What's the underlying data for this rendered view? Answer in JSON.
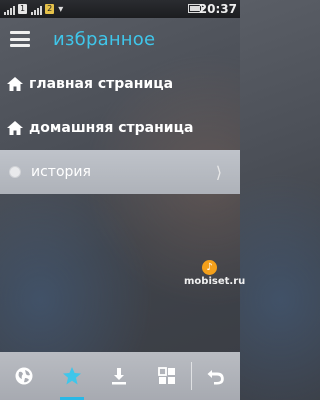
{
  "status_bar": {
    "sim1": "1",
    "sim2": "2",
    "time": "20:37"
  },
  "header": {
    "title": "избранное"
  },
  "list": {
    "items": [
      {
        "label": "главная страница",
        "icon": "home-icon"
      },
      {
        "label": "домашняя страница",
        "icon": "home-icon"
      },
      {
        "label": "история",
        "icon": "radio-icon",
        "selected": true
      }
    ]
  },
  "watermark": {
    "text": "mobiset.ru"
  },
  "toolbar": {
    "buttons": [
      {
        "icon": "globe-icon"
      },
      {
        "icon": "star-icon",
        "active": true
      },
      {
        "icon": "download-icon"
      },
      {
        "icon": "grid-icon"
      },
      {
        "icon": "back-icon"
      }
    ]
  },
  "colors": {
    "accent": "#3fc6ea",
    "selection": "#b8bcc3"
  }
}
